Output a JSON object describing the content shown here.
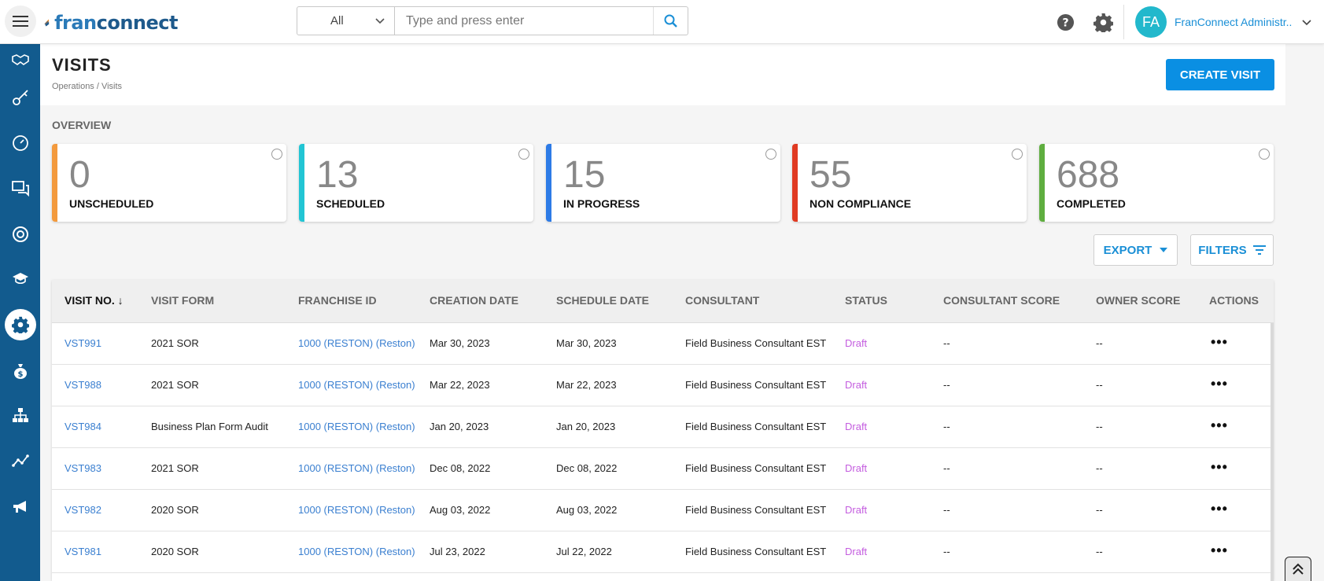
{
  "header": {
    "logo_text_a": "fran",
    "logo_text_b": "connect",
    "search_scope": "All",
    "search_placeholder": "Type and press enter",
    "avatar_initials": "FA",
    "user_name": "FranConnect Administr..."
  },
  "nav": {
    "icons": [
      "handshake-icon",
      "key-icon",
      "gauge-icon",
      "chat-icon",
      "lifebuoy-icon",
      "graduation-cap-icon",
      "gear-icon",
      "money-bag-icon",
      "org-chart-icon",
      "trend-line-icon",
      "megaphone-icon"
    ],
    "active": "gear-icon"
  },
  "page": {
    "title": "VISITS",
    "breadcrumb": "Operations /  Visits",
    "create_button": "CREATE VISIT",
    "overview_label": "OVERVIEW"
  },
  "cards": [
    {
      "value": "0",
      "label": "UNSCHEDULED",
      "color": "#f39a3d"
    },
    {
      "value": "13",
      "label": "SCHEDULED",
      "color": "#22c5d4"
    },
    {
      "value": "15",
      "label": "IN PROGRESS",
      "color": "#2d7be6"
    },
    {
      "value": "55",
      "label": "NON COMPLIANCE",
      "color": "#e03a22"
    },
    {
      "value": "688",
      "label": "COMPLETED",
      "color": "#5fae3f"
    }
  ],
  "toolbar": {
    "export_label": "EXPORT",
    "filters_label": "FILTERS"
  },
  "table": {
    "columns": [
      "VISIT NO. ↓",
      "VISIT FORM",
      "FRANCHISE ID",
      "CREATION DATE",
      "SCHEDULE DATE",
      "CONSULTANT",
      "STATUS",
      "CONSULTANT SCORE",
      "OWNER SCORE",
      "ACTIONS"
    ],
    "rows": [
      {
        "visit_no": "VST991",
        "form": "2021 SOR",
        "franchise": "1000 (RESTON) (Reston)",
        "created": "Mar 30, 2023",
        "scheduled": "Mar 30, 2023",
        "consultant": "Field Business Consultant EST",
        "status": "Draft",
        "consultant_score": "--",
        "owner_score": "--",
        "actions": "•••"
      },
      {
        "visit_no": "VST988",
        "form": "2021 SOR",
        "franchise": "1000 (RESTON) (Reston)",
        "created": "Mar 22, 2023",
        "scheduled": "Mar 22, 2023",
        "consultant": "Field Business Consultant EST",
        "status": "Draft",
        "consultant_score": "--",
        "owner_score": "--",
        "actions": "•••"
      },
      {
        "visit_no": "VST984",
        "form": "Business Plan Form Audit",
        "franchise": "1000 (RESTON) (Reston)",
        "created": "Jan 20, 2023",
        "scheduled": "Jan 20, 2023",
        "consultant": "Field Business Consultant EST",
        "status": "Draft",
        "consultant_score": "--",
        "owner_score": "--",
        "actions": "•••"
      },
      {
        "visit_no": "VST983",
        "form": "2021 SOR",
        "franchise": "1000 (RESTON) (Reston)",
        "created": "Dec 08, 2022",
        "scheduled": "Dec 08, 2022",
        "consultant": "Field Business Consultant EST",
        "status": "Draft",
        "consultant_score": "--",
        "owner_score": "--",
        "actions": "•••"
      },
      {
        "visit_no": "VST982",
        "form": "2020 SOR",
        "franchise": "1000 (RESTON) (Reston)",
        "created": "Aug 03, 2022",
        "scheduled": "Aug 03, 2022",
        "consultant": "Field Business Consultant EST",
        "status": "Draft",
        "consultant_score": "--",
        "owner_score": "--",
        "actions": "•••"
      },
      {
        "visit_no": "VST981",
        "form": "2020 SOR",
        "franchise": "1000 (RESTON) (Reston)",
        "created": "Jul 23, 2022",
        "scheduled": "Jul 22, 2022",
        "consultant": "Field Business Consultant EST",
        "status": "Draft",
        "consultant_score": "--",
        "owner_score": "--",
        "actions": "•••"
      }
    ]
  }
}
